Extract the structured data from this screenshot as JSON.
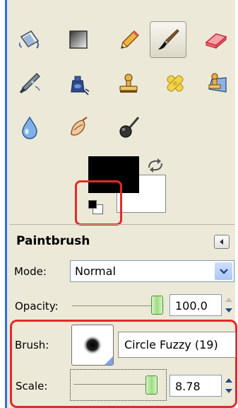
{
  "toolbox": {
    "tools": [
      {
        "name": "bucket-fill-icon"
      },
      {
        "name": "blend-gradient-icon"
      },
      {
        "name": "pencil-icon"
      },
      {
        "name": "paintbrush-icon",
        "active": true
      },
      {
        "name": "eraser-icon"
      },
      {
        "name": "airbrush-icon"
      },
      {
        "name": "ink-icon"
      },
      {
        "name": "clone-stamp-icon"
      },
      {
        "name": "heal-icon"
      },
      {
        "name": "perspective-clone-icon"
      },
      {
        "name": "blur-sharpen-icon"
      },
      {
        "name": "smudge-icon"
      },
      {
        "name": "dodge-burn-icon"
      }
    ]
  },
  "colors": {
    "foreground": "#000000",
    "background": "#ffffff",
    "highlight": "#e32a2a"
  },
  "tool_options": {
    "title": "Paintbrush",
    "mode_label": "Mode:",
    "mode_value": "Normal",
    "opacity_label": "Opacity:",
    "opacity_value": "100.0",
    "brush_label": "Brush:",
    "brush_name": "Circle Fuzzy (19)",
    "scale_label": "Scale:",
    "scale_value": "8.78"
  }
}
